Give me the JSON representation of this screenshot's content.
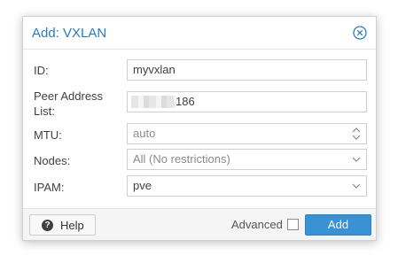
{
  "dialog": {
    "title": "Add: VXLAN",
    "close_icon": "close-circle-icon"
  },
  "form": {
    "id": {
      "label": "ID:",
      "value": "myvxlan"
    },
    "peers": {
      "label_line1": "Peer Address",
      "label_line2": "List:",
      "value_suffix": "186"
    },
    "mtu": {
      "label": "MTU:",
      "placeholder": "auto",
      "icon": "spinner-up-down-icon"
    },
    "nodes": {
      "label": "Nodes:",
      "value": "All (No restrictions)",
      "icon": "chevron-down-icon"
    },
    "ipam": {
      "label": "IPAM:",
      "value": "pve",
      "icon": "chevron-down-icon"
    }
  },
  "footer": {
    "help_label": "Help",
    "help_icon": "question-circle-icon",
    "advanced_label": "Advanced",
    "advanced_checked": false,
    "add_label": "Add"
  },
  "colors": {
    "accent": "#2b7bc0",
    "primary_button": "#3892d3"
  }
}
